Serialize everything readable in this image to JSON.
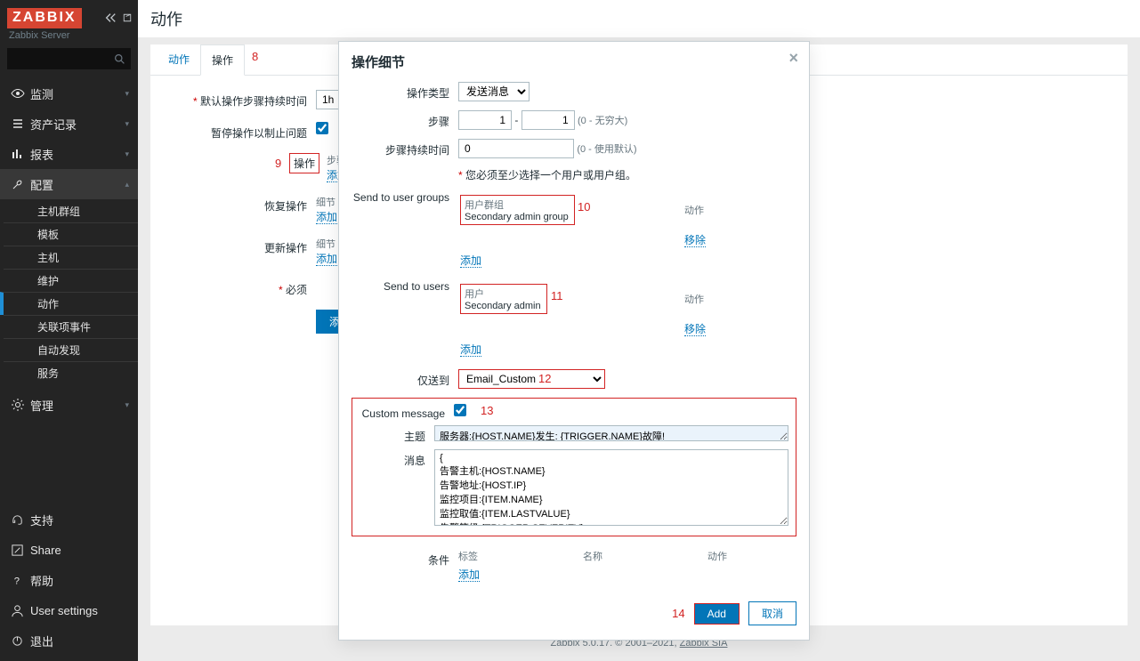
{
  "brand": {
    "logo": "ZABBIX",
    "server": "Zabbix Server"
  },
  "search": {
    "placeholder": ""
  },
  "nav": {
    "monitor": "监测",
    "inventory": "资产记录",
    "report": "报表",
    "config": "配置",
    "admin": "管理",
    "support": "支持",
    "share": "Share",
    "help": "帮助",
    "usersettings": "User settings",
    "logout": "退出"
  },
  "subnav": {
    "hostgroup": "主机群组",
    "template": "模板",
    "host": "主机",
    "maintain": "维护",
    "action": "动作",
    "event": "关联项事件",
    "discovery": "自动发现",
    "service": "服务"
  },
  "header": {
    "title": "动作"
  },
  "tabs": {
    "tab1": "动作",
    "tab2": "操作"
  },
  "annots": {
    "a8": "8",
    "a9": "9",
    "a10": "10",
    "a11": "11",
    "a12": "12",
    "a13": "13",
    "a14": "14"
  },
  "form": {
    "default_duration_label": "默认操作步骤持续时间",
    "default_duration_value": "1h",
    "pause_label": "暂停操作以制止问题",
    "ops_label": "操作",
    "ops_col_steps": "步骤",
    "ops_add": "添加",
    "recover_label": "恢复操作",
    "recover_col": "细节",
    "recover_add": "添加",
    "update_label": "更新操作",
    "update_col": "细节",
    "update_add": "添加",
    "req_note": "必须",
    "update_btn": "添加"
  },
  "modal": {
    "title": "操作细节",
    "optype_label": "操作类型",
    "optype_value": "发送消息",
    "steps_label": "步骤",
    "step_from": "1",
    "step_to": "1",
    "steps_hint": "(0 - 无穷大)",
    "duration_label": "步骤持续时间",
    "duration_value": "0",
    "duration_hint": "(0 - 使用默认)",
    "must_select": "您必须至少选择一个用户或用户组。",
    "send_groups_label": "Send to user groups",
    "groups_header": "用户群组",
    "action_header": "动作",
    "group1": "Secondary admin group",
    "remove": "移除",
    "groups_add": "添加",
    "send_users_label": "Send to users",
    "users_header": "用户",
    "user1": "Secondary admin",
    "users_add": "添加",
    "sendto_label": "仅送到",
    "sendto_value": "Email_Custom",
    "custommsg_label": "Custom message",
    "subject_label": "主题",
    "subject_value": "服务器:{HOST.NAME}发生: {TRIGGER.NAME}故障!",
    "message_label": "消息",
    "message_value": "{\n告警主机:{HOST.NAME}\n告警地址:{HOST.IP}\n监控项目:{ITEM.NAME}\n监控取值:{ITEM.LASTVALUE}\n告警等级:{TRIGGER.SEVERITY}",
    "cond_label": "条件",
    "cond_h1": "标签",
    "cond_h2": "名称",
    "cond_h3": "动作",
    "cond_add": "添加",
    "add_btn": "Add",
    "cancel_btn": "取消"
  },
  "footer": {
    "text": "Zabbix 5.0.17. © 2001–2021, ",
    "link": "Zabbix SIA"
  }
}
